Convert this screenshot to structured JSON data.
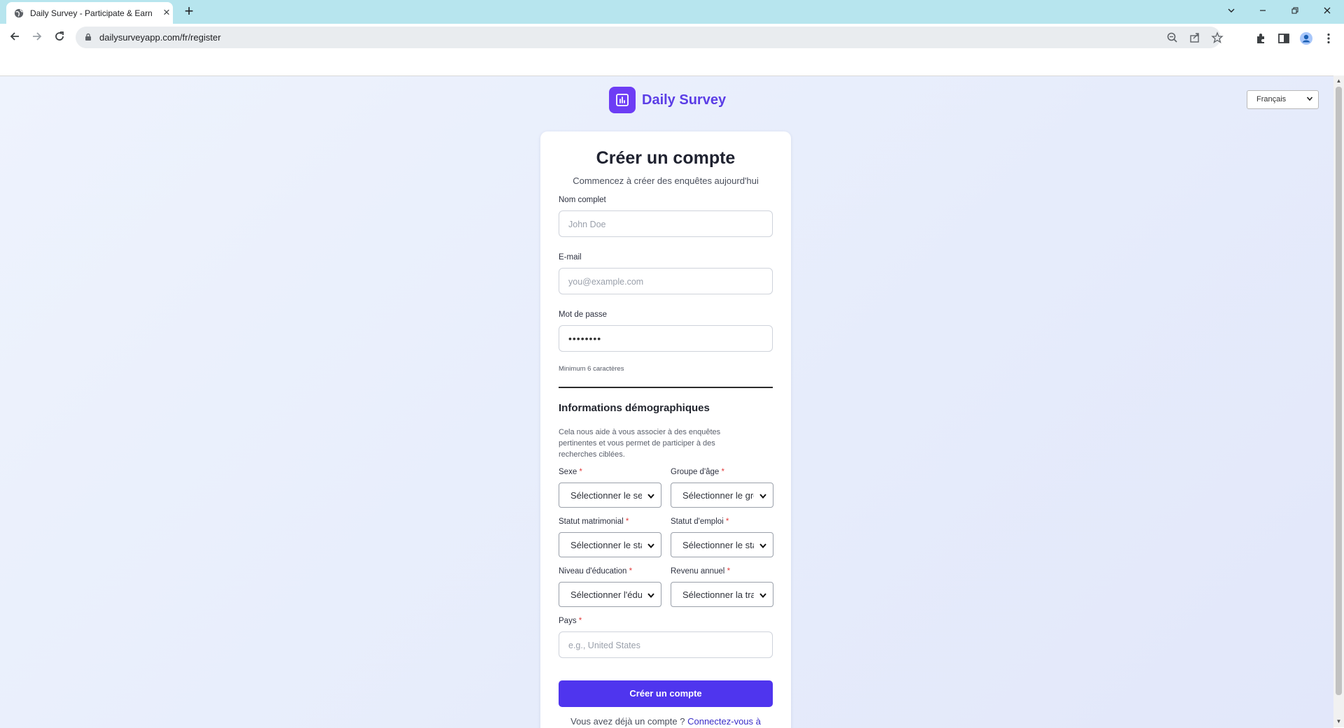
{
  "browser": {
    "tab_title": "Daily Survey - Participate & Earn",
    "url": "dailysurveyapp.com/fr/register"
  },
  "header": {
    "brand_name": "Daily Survey",
    "language_selected": "Français"
  },
  "form": {
    "title": "Créer un compte",
    "subtitle": "Commencez à créer des enquêtes aujourd'hui",
    "full_name": {
      "label": "Nom complet",
      "placeholder": "John Doe"
    },
    "email": {
      "label": "E-mail",
      "placeholder": "you@example.com"
    },
    "password": {
      "label": "Mot de passe",
      "value": "••••••••",
      "hint": "Minimum 6 caractères"
    },
    "demographics": {
      "title": "Informations démographiques",
      "description": "Cela nous aide à vous associer à des enquêtes pertinentes et vous permet de participer à des recherches ciblées.",
      "gender": {
        "label": "Sexe",
        "value": "Sélectionner le sexe"
      },
      "age_group": {
        "label": "Groupe d'âge",
        "value": "Sélectionner le groupe d'âge"
      },
      "marital_status": {
        "label": "Statut matrimonial",
        "value": "Sélectionner le statut"
      },
      "employment_status": {
        "label": "Statut d'emploi",
        "value": "Sélectionner le statut"
      },
      "education_level": {
        "label": "Niveau d'éducation",
        "value": "Sélectionner l'éducation"
      },
      "annual_income": {
        "label": "Revenu annuel",
        "value": "Sélectionner la tranche"
      },
      "country": {
        "label": "Pays",
        "placeholder": "e.g., United States"
      },
      "required_mark": "*"
    },
    "submit_label": "Créer un compte",
    "footer_text": "Vous avez déjà un compte ?",
    "footer_link": "Connectez-vous à"
  },
  "colors": {
    "primary": "#4f35ee",
    "brand": "#6d3df5",
    "required": "#e23d3d",
    "tabbar": "#b7e5ee"
  },
  "icons": [
    "globe-icon",
    "close-icon",
    "plus-icon",
    "back-icon",
    "forward-icon",
    "reload-icon",
    "lock-icon",
    "zoom-icon",
    "share-icon",
    "star-icon",
    "extensions-icon",
    "sidepanel-icon",
    "profile-icon",
    "menu-icon",
    "bar-chart-icon",
    "chevron-down-icon"
  ]
}
